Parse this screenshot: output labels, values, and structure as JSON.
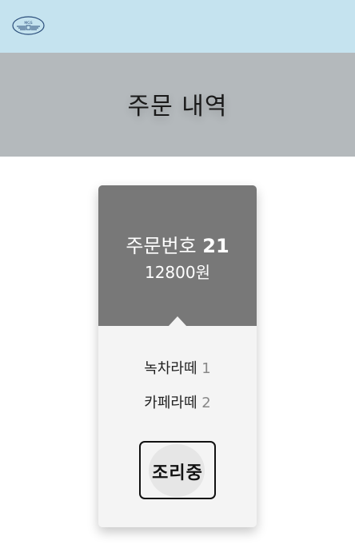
{
  "header": {
    "logo": {
      "icon": "wings-logo-icon",
      "text": "MGS",
      "color": "#2a4d7a"
    },
    "background": "#c5e3ef"
  },
  "banner": {
    "title": "주문 내역",
    "background": "#b4b9bc"
  },
  "order": {
    "label": "주문번호",
    "number": "21",
    "price": "12800원",
    "items": [
      {
        "name": "녹차라떼",
        "qty": "1"
      },
      {
        "name": "카페라떼",
        "qty": "2"
      }
    ],
    "status_label": "조리중"
  }
}
